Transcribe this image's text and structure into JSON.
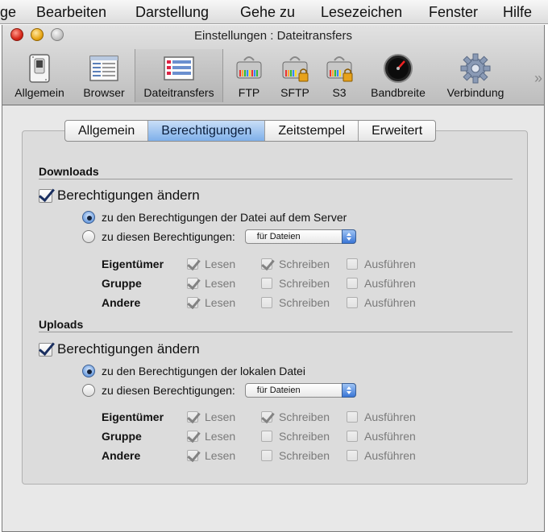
{
  "menubar": {
    "items": [
      "ge",
      "Bearbeiten",
      "Darstellung",
      "Gehe zu",
      "Lesezeichen",
      "Fenster",
      "Hilfe"
    ]
  },
  "window": {
    "title": "Einstellungen : Dateitransfers"
  },
  "toolbar": {
    "items": [
      {
        "label": "Allgemein",
        "icon": "switch-icon"
      },
      {
        "label": "Browser",
        "icon": "browser-window-icon"
      },
      {
        "label": "Dateitransfers",
        "icon": "transfer-list-icon",
        "selected": true
      },
      {
        "label": "FTP",
        "icon": "server-drive-icon"
      },
      {
        "label": "SFTP",
        "icon": "locked-server-drive-icon"
      },
      {
        "label": "S3",
        "icon": "locked-server-drive-icon"
      },
      {
        "label": "Bandbreite",
        "icon": "speedometer-icon"
      },
      {
        "label": "Verbindung",
        "icon": "gear-icon"
      }
    ],
    "overflow_icon": "double-chevron-right-icon"
  },
  "tabs": [
    {
      "label": "Allgemein"
    },
    {
      "label": "Berechtigungen",
      "active": true
    },
    {
      "label": "Zeitstempel"
    },
    {
      "label": "Erweitert"
    }
  ],
  "downloads": {
    "title": "Downloads",
    "change_label": "Berechtigungen ändern",
    "change_checked": true,
    "radio_server": "zu den Berechtigungen der Datei auf dem Server",
    "radio_custom": "zu diesen Berechtigungen:",
    "popup_value": "für Dateien",
    "rows": [
      {
        "name": "Eigentümer",
        "read": "Lesen",
        "write": "Schreiben",
        "exec": "Ausführen",
        "read_checked": true,
        "write_checked": true,
        "exec_checked": false
      },
      {
        "name": "Gruppe",
        "read": "Lesen",
        "write": "Schreiben",
        "exec": "Ausführen",
        "read_checked": true,
        "write_checked": false,
        "exec_checked": false
      },
      {
        "name": "Andere",
        "read": "Lesen",
        "write": "Schreiben",
        "exec": "Ausführen",
        "read_checked": true,
        "write_checked": false,
        "exec_checked": false
      }
    ]
  },
  "uploads": {
    "title": "Uploads",
    "change_label": "Berechtigungen ändern",
    "change_checked": true,
    "radio_local": "zu den Berechtigungen der lokalen Datei",
    "radio_custom": "zu diesen Berechtigungen:",
    "popup_value": "für Dateien",
    "rows": [
      {
        "name": "Eigentümer",
        "read": "Lesen",
        "write": "Schreiben",
        "exec": "Ausführen",
        "read_checked": true,
        "write_checked": true,
        "exec_checked": false
      },
      {
        "name": "Gruppe",
        "read": "Lesen",
        "write": "Schreiben",
        "exec": "Ausführen",
        "read_checked": true,
        "write_checked": false,
        "exec_checked": false
      },
      {
        "name": "Andere",
        "read": "Lesen",
        "write": "Schreiben",
        "exec": "Ausführen",
        "read_checked": true,
        "write_checked": false,
        "exec_checked": false
      }
    ]
  }
}
